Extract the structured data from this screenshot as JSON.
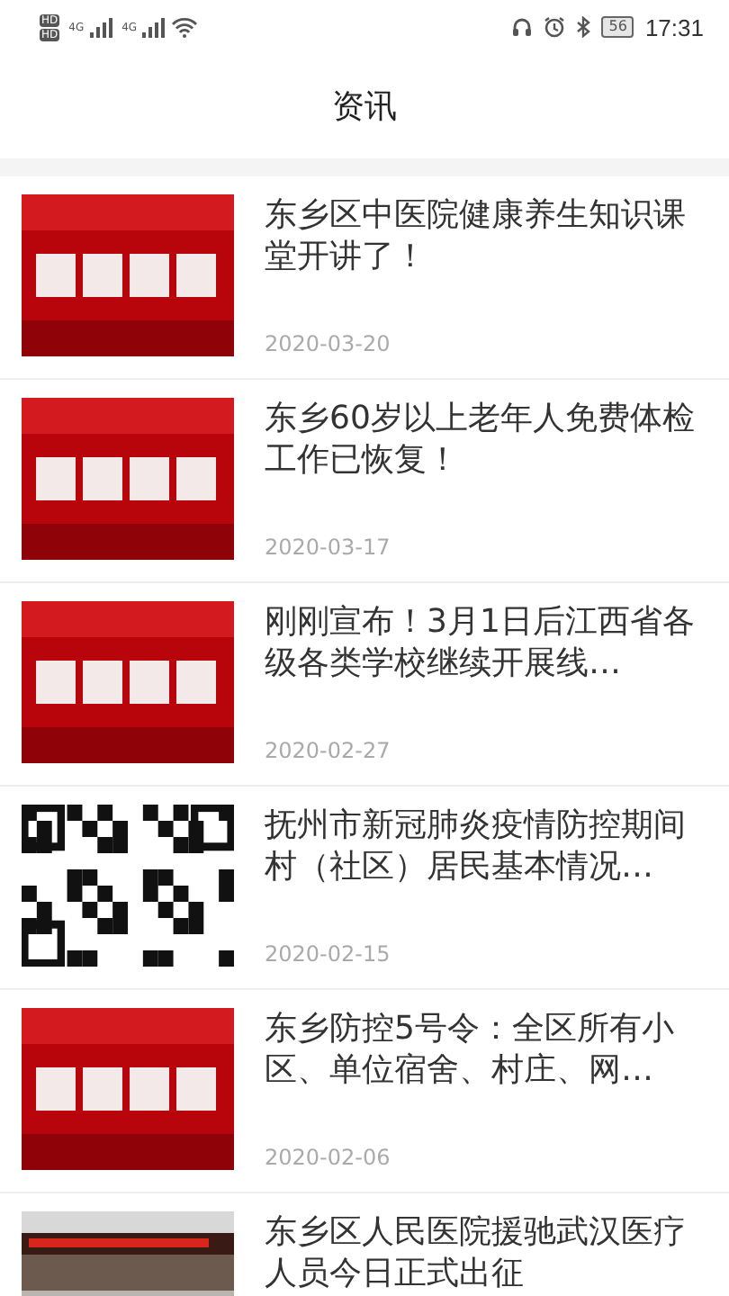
{
  "status_bar": {
    "sim_badges": [
      "HD",
      "HD"
    ],
    "network_labels": [
      "4G",
      "4G"
    ],
    "battery": "56",
    "time": "17:31"
  },
  "header": {
    "title": "资讯"
  },
  "news": [
    {
      "title": "东乡区中医院健康养生知识课堂开讲了！",
      "date": "2020-03-20",
      "thumb": {
        "kind": "banner"
      }
    },
    {
      "title": "东乡60岁以上老年人免费体检工作已恢复！",
      "date": "2020-03-17",
      "thumb": {
        "kind": "banner"
      }
    },
    {
      "title": "刚刚宣布！3月1日后江西省各级各类学校继续开展线…",
      "date": "2020-02-27",
      "thumb": {
        "kind": "banner"
      }
    },
    {
      "title": "抚州市新冠肺炎疫情防控期间村（社区）居民基本情况…",
      "date": "2020-02-15",
      "thumb": {
        "kind": "qr"
      }
    },
    {
      "title": "东乡防控5号令：全区所有小区、单位宿舍、村庄、网…",
      "date": "2020-02-06",
      "thumb": {
        "kind": "banner"
      }
    },
    {
      "title": "东乡区人民医院援驰武汉医疗人员今日正式出征"
    }
  ]
}
